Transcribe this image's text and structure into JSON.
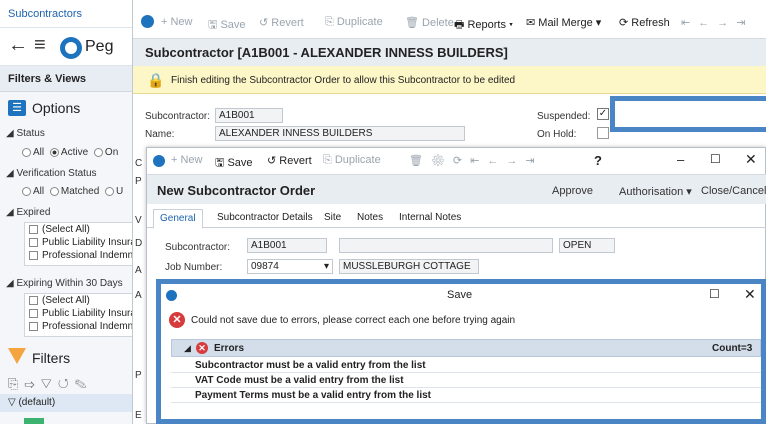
{
  "left": {
    "tab_title": "Subcontractors",
    "app_name": "Peg",
    "filters_views": "Filters & Views",
    "options": "Options",
    "status": {
      "label": "Status",
      "opt_all": "All",
      "opt_active": "Active",
      "opt_on": "On"
    },
    "verification": {
      "label": "Verification Status",
      "opt_all": "All",
      "opt_matched": "Matched",
      "opt_u": "U"
    },
    "expired": {
      "label": "Expired",
      "items": [
        "(Select All)",
        "Public Liability Insura",
        "Professional Indemnit"
      ]
    },
    "expiring": {
      "label": "Expiring Within 30 Days",
      "items": [
        "(Select All)",
        "Public Liability Insura",
        "Professional Indemni"
      ]
    },
    "filters": "Filters",
    "default_filter": "(default)"
  },
  "toolbar1": {
    "new": "New",
    "save": "Save",
    "revert": "Revert",
    "duplicate": "Duplicate",
    "delete": "Delete",
    "reports": "Reports",
    "mail_merge": "Mail Merge",
    "refresh": "Refresh"
  },
  "record": {
    "header": "Subcontractor [A1B001 - ALEXANDER INNESS BUILDERS]",
    "warning": "Finish editing the Subcontractor Order to allow this Subcontractor to be edited",
    "subcontractor_label": "Subcontractor:",
    "subcontractor_value": "A1B001",
    "name_label": "Name:",
    "name_value": "ALEXANDER INNESS BUILDERS",
    "suspended_label": "Suspended:",
    "onhold_label": "On Hold:",
    "side_letters": [
      "C",
      "P",
      "V",
      "D",
      "A",
      "A",
      "P",
      "E"
    ]
  },
  "order": {
    "toolbar": {
      "new": "New",
      "save": "Save",
      "revert": "Revert",
      "duplicate": "Duplicate",
      "help": "?"
    },
    "header": "New Subcontractor Order",
    "approve": "Approve",
    "authorisation": "Authorisation",
    "close_cancel": "Close/Cancel",
    "tabs": [
      "General",
      "Subcontractor Details",
      "Site",
      "Notes",
      "Internal Notes"
    ],
    "subcontractor_label": "Subcontractor:",
    "subcontractor_value": "A1B001",
    "status_value": "OPEN",
    "job_label": "Job Number:",
    "job_value": "09874",
    "job_name": "MUSSLEBURGH COTTAGE"
  },
  "save_dialog": {
    "title": "Save",
    "message": "Could not save due to errors, please correct each one before trying again",
    "errors_label": "Errors",
    "count": "Count=3",
    "errors": [
      "Subcontractor must be a valid entry from the list",
      "VAT Code must be a valid entry from the list",
      "Payment Terms must be a valid entry from the list"
    ]
  }
}
